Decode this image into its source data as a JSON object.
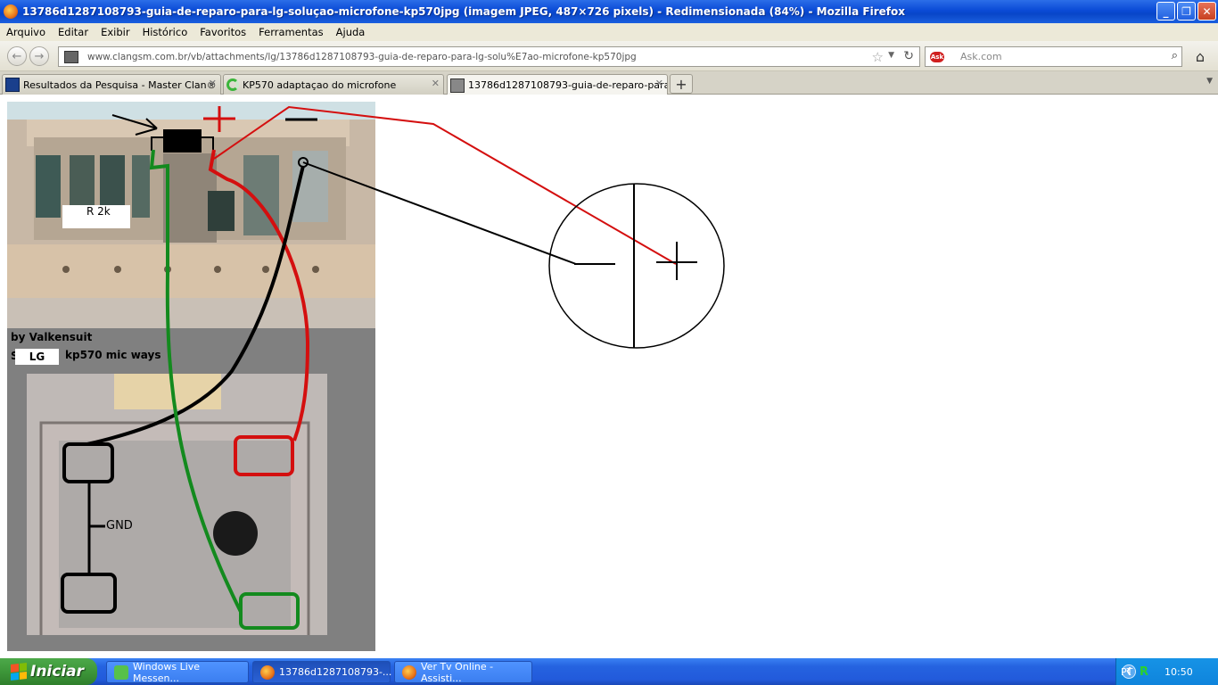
{
  "window": {
    "title": "13786d1287108793-guia-de-reparo-para-lg-soluçao-microfone-kp570jpg (imagem JPEG, 487×726 pixels) - Redimensionada (84%) - Mozilla Firefox",
    "buttons": {
      "minimize": "_",
      "maximize": "❐",
      "close": "✕"
    }
  },
  "menu": [
    "Arquivo",
    "Editar",
    "Exibir",
    "Histórico",
    "Favoritos",
    "Ferramentas",
    "Ajuda"
  ],
  "nav": {
    "back_icon": "←",
    "forward_icon": "→",
    "url": "www.clangsm.com.br/vb/attachments/lg/13786d1287108793-guia-de-reparo-para-lg-solu%E7ao-microfone-kp570jpg",
    "search_placeholder": "Ask.com",
    "search_engine_badge": "Ask"
  },
  "tabs": [
    {
      "label": "Resultados da Pesquisa - Master Clan®",
      "active": false
    },
    {
      "label": "KP570 adaptaçao do microfone",
      "active": false
    },
    {
      "label": "13786d1287108793-guia-de-reparo-para-...",
      "active": true
    }
  ],
  "image": {
    "resistor_label": "R 2k",
    "credit": "by Valkensuit",
    "brand_box": "LG",
    "caption_prefix": "S",
    "caption": "kp570 mic ways",
    "gnd_label": "GND",
    "wire_colors": {
      "positive": "#d40f0f",
      "negative": "#000000",
      "ground": "#138a1e"
    }
  },
  "taskbar": {
    "start_label": "Iniciar",
    "items": [
      {
        "label": "Windows Live Messen...",
        "active": false
      },
      {
        "label": "13786d1287108793-...",
        "active": true
      },
      {
        "label": "Ver Tv Online - Assisti...",
        "active": false
      }
    ],
    "language": "PT",
    "clock": "10:50"
  }
}
